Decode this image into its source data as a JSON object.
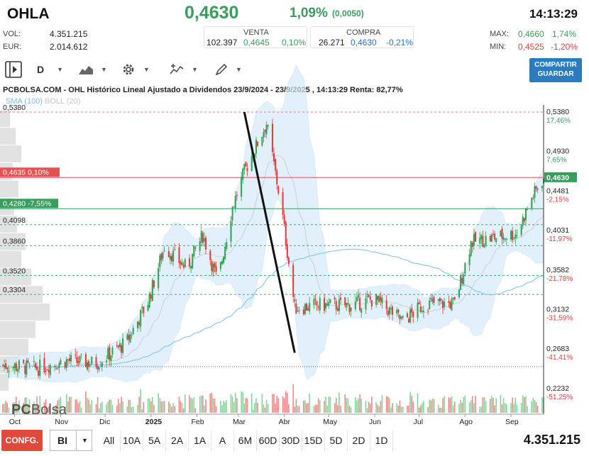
{
  "header": {
    "ticker": "OHLA",
    "price": "0,4630",
    "change_pct": "1,09%",
    "change_abs": "(0,0050)",
    "time": "14:13:29",
    "vol_label": "VOL:",
    "vol_value": "4.351.215",
    "eur_label": "EUR:",
    "eur_value": "2.014.612",
    "max_label": "MAX:",
    "max_value": "0,4660",
    "max_pct": "1,74%",
    "min_label": "MIN:",
    "min_value": "0,4525",
    "min_pct": "-1,20%"
  },
  "quotes": {
    "sell_label": "VENTA",
    "sell_qty": "102.397",
    "sell_price": "0,4645",
    "sell_pct": "0,10%",
    "buy_label": "COMPRA",
    "buy_qty": "26.271",
    "buy_price": "0,4630",
    "buy_pct": "-0,21%"
  },
  "toolbar": {
    "period": "D",
    "share_line1": "COMPARTIR",
    "share_line2": "GUARDAR"
  },
  "legend": {
    "sma": "SMA (100)",
    "boll": "BOLL (20)"
  },
  "watermark": {
    "pc": "PC",
    "bolsa": "Bolsa"
  },
  "bottom": {
    "config": "CONFG.",
    "select": "BI",
    "ranges": [
      "All",
      "10A",
      "5A",
      "2A",
      "1A",
      "A",
      "6M",
      "60D",
      "30D",
      "15D",
      "5D",
      "2D",
      "1D"
    ],
    "volume_total": "4.351.215"
  },
  "chart_data": {
    "type": "candlestick",
    "title": "PCBOLSA.COM - OHL Histórico Lineal Ajustado a Dividendos 23/9/2024 - 23/9/2025 , 14:13:29 Renta: 82,77%",
    "x_ticks": [
      "Oct",
      "Nov",
      "Dic",
      "2025",
      "Feb",
      "Mar",
      "Abr",
      "May",
      "Jun",
      "Jul",
      "Ago",
      "Sep"
    ],
    "ylim": [
      0.2232,
      0.538
    ],
    "right_ticks": [
      {
        "value": "0,5380",
        "pct": "17,46%"
      },
      {
        "value": "0,4930",
        "pct": "7,65%"
      },
      {
        "value": "0,4481",
        "pct": "-2,15%"
      },
      {
        "value": "0,4031",
        "pct": "-11,97%"
      },
      {
        "value": "0,3582",
        "pct": "-21,78%"
      },
      {
        "value": "0,3132",
        "pct": "-31,59%"
      },
      {
        "value": "0,2683",
        "pct": "-41,41%"
      },
      {
        "value": "0,2232",
        "pct": "-51,25%"
      }
    ],
    "last_price_label": "0,4630",
    "levels": [
      {
        "label": "0,5380",
        "value": 0.538,
        "style": "dashed-red"
      },
      {
        "label": "0,4635  0,10%",
        "value": 0.4635,
        "style": "solid-red"
      },
      {
        "label": "0,4280  -7,55%",
        "value": 0.428,
        "style": "solid-green"
      },
      {
        "label": "0,4098",
        "value": 0.4098,
        "style": "dashed-green"
      },
      {
        "label": "0,3860",
        "value": 0.386,
        "style": "dashed-green"
      },
      {
        "label": "0,3520",
        "value": 0.352,
        "style": "dashed-green"
      },
      {
        "label": "0,3304",
        "value": 0.3304,
        "style": "dashed-green"
      }
    ],
    "trendline": {
      "from": {
        "date": "2025-03-05",
        "price": 0.538
      },
      "to": {
        "date": "2025-04-08",
        "price": 0.264
      }
    },
    "close_path": [
      {
        "date": "2024-09-24",
        "price": 0.25
      },
      {
        "date": "2024-10-15",
        "price": 0.246
      },
      {
        "date": "2024-11-05",
        "price": 0.255
      },
      {
        "date": "2024-11-25",
        "price": 0.252
      },
      {
        "date": "2024-12-15",
        "price": 0.275
      },
      {
        "date": "2024-12-30",
        "price": 0.322
      },
      {
        "date": "2025-01-10",
        "price": 0.385
      },
      {
        "date": "2025-01-25",
        "price": 0.36
      },
      {
        "date": "2025-02-05",
        "price": 0.398
      },
      {
        "date": "2025-02-15",
        "price": 0.345
      },
      {
        "date": "2025-02-25",
        "price": 0.43
      },
      {
        "date": "2025-03-05",
        "price": 0.47
      },
      {
        "date": "2025-03-20",
        "price": 0.525
      },
      {
        "date": "2025-03-30",
        "price": 0.43
      },
      {
        "date": "2025-04-08",
        "price": 0.315
      },
      {
        "date": "2025-04-25",
        "price": 0.318
      },
      {
        "date": "2025-05-15",
        "price": 0.318
      },
      {
        "date": "2025-06-01",
        "price": 0.325
      },
      {
        "date": "2025-06-20",
        "price": 0.3
      },
      {
        "date": "2025-07-05",
        "price": 0.32
      },
      {
        "date": "2025-07-25",
        "price": 0.32
      },
      {
        "date": "2025-08-05",
        "price": 0.39
      },
      {
        "date": "2025-08-20",
        "price": 0.395
      },
      {
        "date": "2025-09-05",
        "price": 0.4
      },
      {
        "date": "2025-09-15",
        "price": 0.44
      },
      {
        "date": "2025-09-23",
        "price": 0.463
      }
    ]
  }
}
